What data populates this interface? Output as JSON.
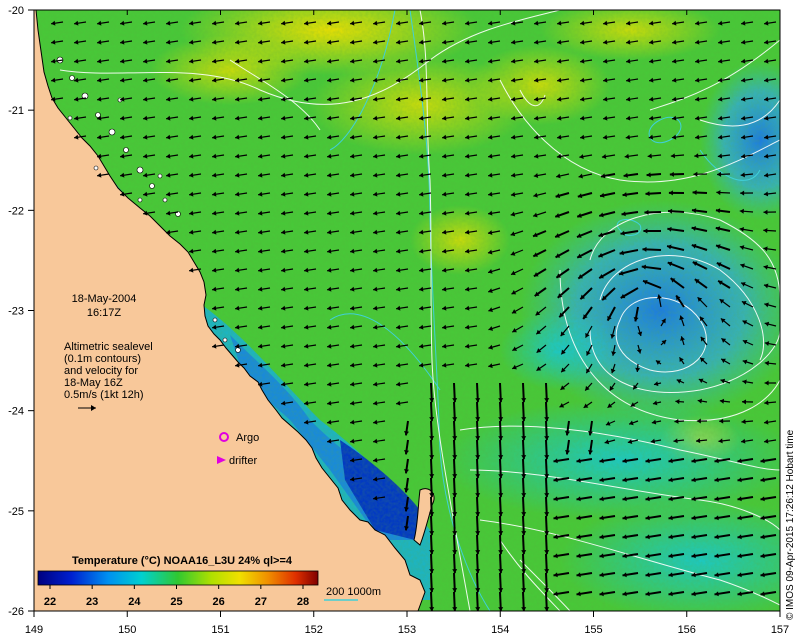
{
  "map": {
    "lon_ticks": [
      "149",
      "150",
      "151",
      "152",
      "153",
      "154",
      "155",
      "156",
      "157"
    ],
    "lat_ticks": [
      "-20",
      "-21",
      "-22",
      "-23",
      "-24",
      "-25",
      "-26"
    ],
    "date_line1": "18-May-2004",
    "date_line2": "16:17Z",
    "note_lines": [
      "Altimetric sealevel",
      "(0.1m contours)",
      "and velocity for",
      "18-May 16Z",
      "0.5m/s (1kt 12h)"
    ],
    "legend_argo": "Argo",
    "legend_drifter": "drifter",
    "colorbar_title": "Temperature (°C) NOAA16_L3U 24% ql>=4",
    "colorbar_ticks": [
      "22",
      "23",
      "24",
      "25",
      "26",
      "27",
      "28"
    ],
    "depth_label": "200  1000m",
    "credit": "© IMOS 09-Apr-2015 17:26:12 Hobart time",
    "colors": {
      "land": "#f8c89a",
      "contour": "#ffffff",
      "bathy": "#40d0d8",
      "argo": "#e000e0",
      "arrow": "#000000"
    }
  }
}
